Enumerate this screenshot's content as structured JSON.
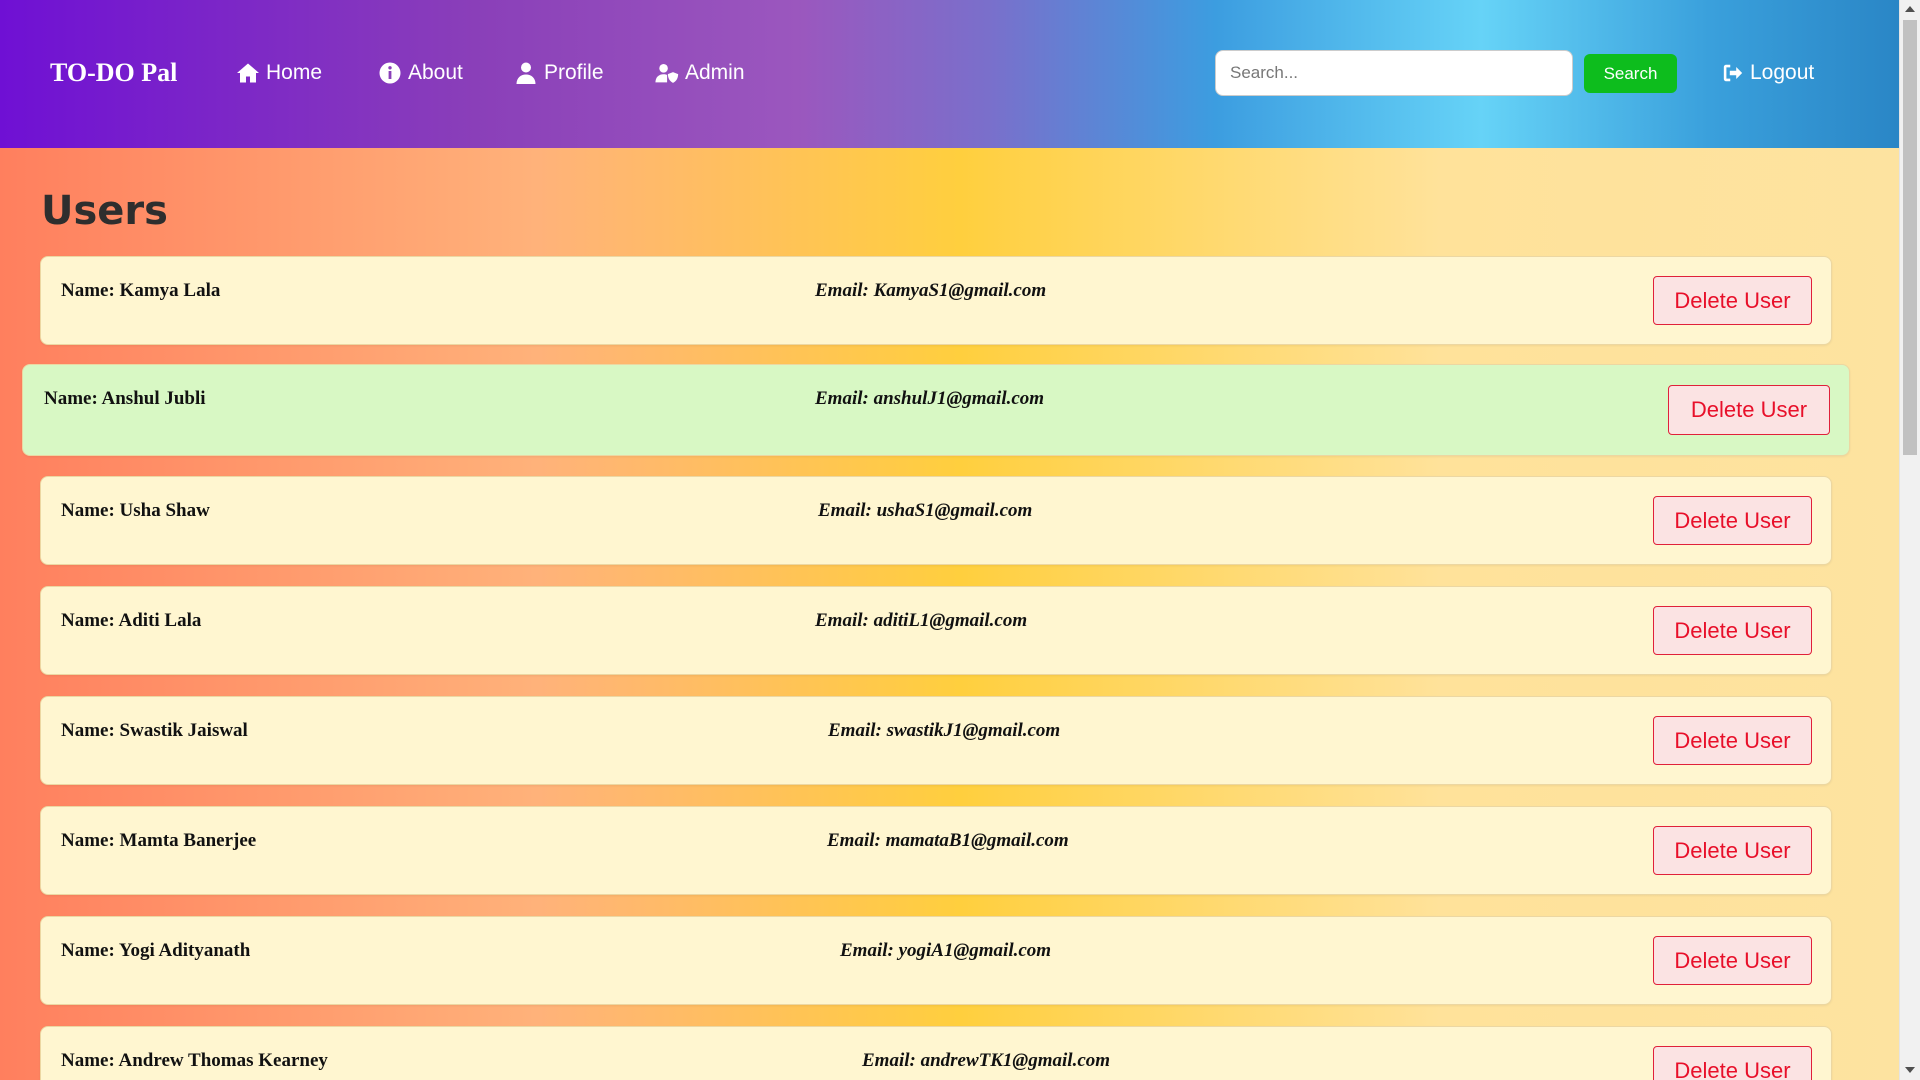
{
  "navbar": {
    "brand": "TO-DO Pal",
    "items": [
      {
        "label": "Home",
        "icon": "home-icon"
      },
      {
        "label": "About",
        "icon": "info-icon"
      },
      {
        "label": "Profile",
        "icon": "user-icon"
      },
      {
        "label": "Admin",
        "icon": "user-shield-icon"
      }
    ],
    "search": {
      "placeholder": "Search...",
      "value": "",
      "button_label": "Search"
    },
    "logout": {
      "label": "Logout",
      "icon": "sign-out-icon"
    }
  },
  "main": {
    "title": "Users",
    "users": [
      {
        "name": "Name: Kamya Lala",
        "email": "Email: KamyaS1@gmail.com",
        "delete_label": "Delete User",
        "highlighted": false
      },
      {
        "name": "Name: Anshul Jubli",
        "email": "Email: anshulJ1@gmail.com",
        "delete_label": "Delete User",
        "highlighted": true
      },
      {
        "name": "Name: Usha Shaw",
        "email": "Email: ushaS1@gmail.com",
        "delete_label": "Delete User",
        "highlighted": false
      },
      {
        "name": "Name: Aditi Lala",
        "email": "Email: aditiL1@gmail.com",
        "delete_label": "Delete User",
        "highlighted": false
      },
      {
        "name": "Name: Swastik Jaiswal",
        "email": "Email: swastikJ1@gmail.com",
        "delete_label": "Delete User",
        "highlighted": false
      },
      {
        "name": "Name: Mamta Banerjee",
        "email": "Email: mamataB1@gmail.com",
        "delete_label": "Delete User",
        "highlighted": false
      },
      {
        "name": "Name: Yogi Adityanath",
        "email": "Email: yogiA1@gmail.com",
        "delete_label": "Delete User",
        "highlighted": false
      },
      {
        "name": "Name: Andrew Thomas Kearney",
        "email": "Email: andrewTK1@gmail.com",
        "delete_label": "Delete User",
        "highlighted": false
      }
    ]
  },
  "colors": {
    "navbar_start": "#6f10d4",
    "navbar_end": "#2a86c6",
    "search_button": "#0dbd1d",
    "card_background": "#fff6d0",
    "card_highlight": "#d8f8c4",
    "delete_text": "#e8102a"
  }
}
